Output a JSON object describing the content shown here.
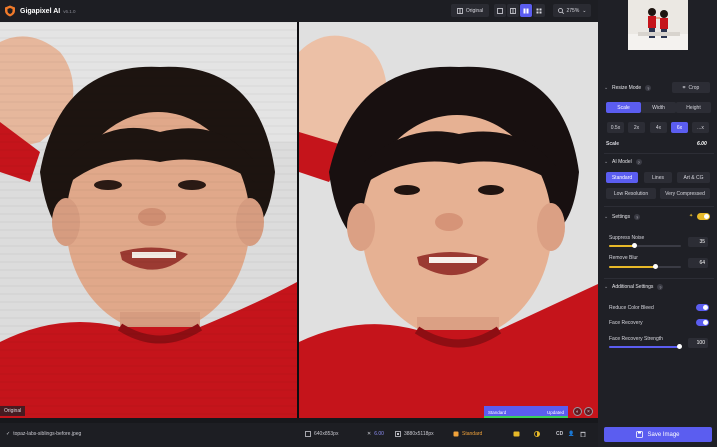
{
  "app": {
    "title": "Gigapixel AI",
    "version": "v6.1.0"
  },
  "toolbar": {
    "original_label": "Original",
    "zoom": "275%"
  },
  "view": {
    "left_tag": "Original",
    "model_bar_left": "Standard",
    "model_bar_right": "Updated"
  },
  "status": {
    "filename": "topaz-labs-siblings-before.jpeg",
    "input_size": "640x853px",
    "scale": "6.00",
    "output_size": "3880x5118px",
    "model": "Standard",
    "cd_label": "CD"
  },
  "sidebar": {
    "resize_mode_label": "Resize Mode",
    "crop_label": "Crop",
    "resize_tabs": [
      "Scale",
      "Width",
      "Height"
    ],
    "scale_options": [
      "0.5x",
      "2x",
      "4x",
      "6x",
      "...x"
    ],
    "scale_label": "Scale",
    "scale_value": "6.00",
    "ai_model_label": "AI Model",
    "models_row1": [
      "Standard",
      "Lines",
      "Art & CG"
    ],
    "models_row2": [
      "Low Resolution",
      "Very Compressed"
    ],
    "settings_label": "Settings",
    "suppress_noise_label": "Suppress Noise",
    "suppress_noise_value": "35",
    "remove_blur_label": "Remove Blur",
    "remove_blur_value": "64",
    "additional_settings_label": "Additional Settings",
    "reduce_color_bleed_label": "Reduce Color Bleed",
    "face_recovery_label": "Face Recovery",
    "face_recovery_strength_label": "Face Recovery Strength",
    "face_recovery_strength_value": "100",
    "save_label": "Save Image"
  },
  "colors": {
    "accent": "#5b5df0",
    "panel": "#1f2026",
    "shirt_red": "#c5141b",
    "progress_green": "#3bd15a",
    "settings_toggle": "#e7b928"
  }
}
